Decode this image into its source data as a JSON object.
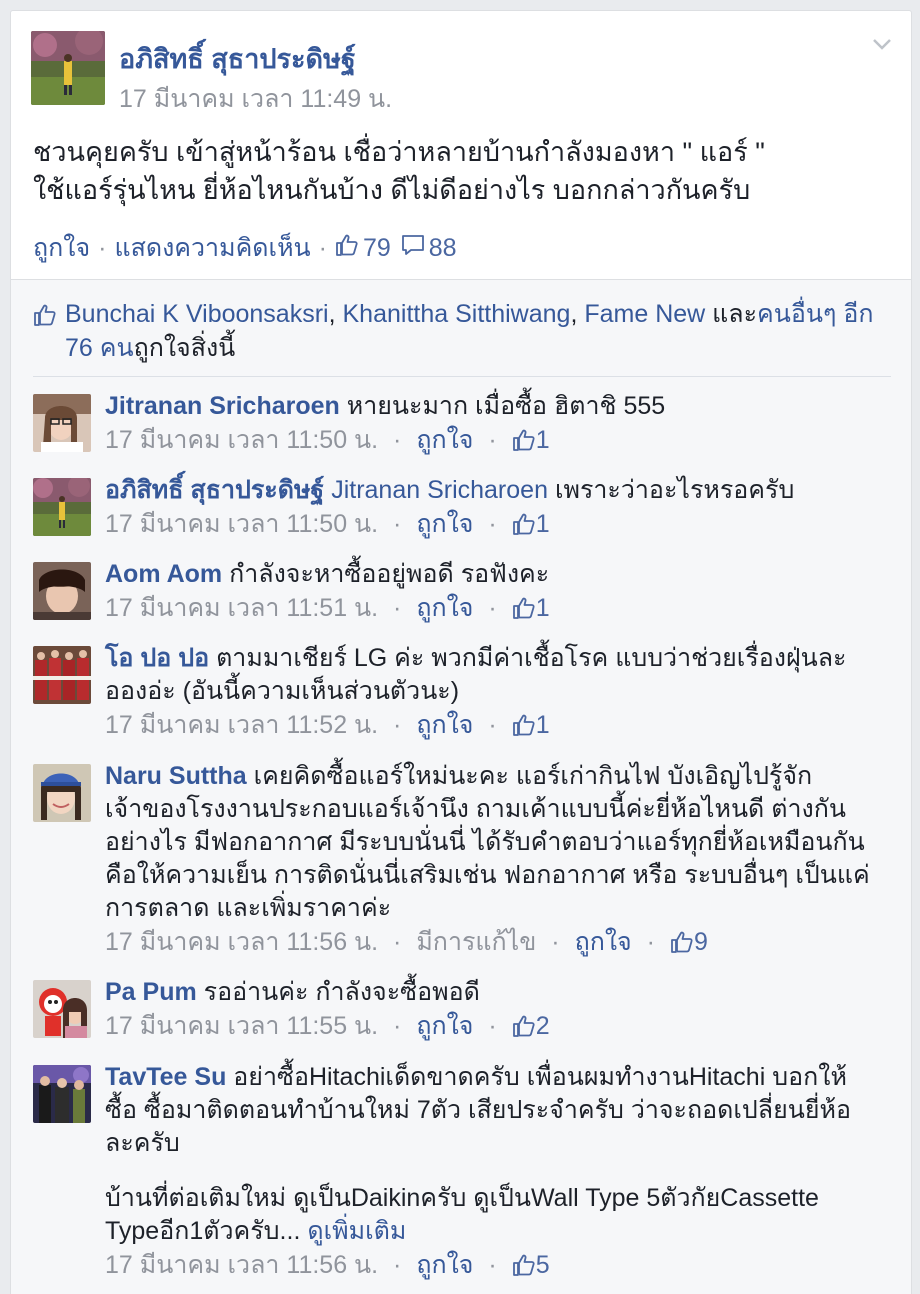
{
  "post": {
    "author": "อภิสิทธิ์ สุธาประดิษฐ์",
    "time": "17 มีนาคม เวลา 11:49 น.",
    "text_line1": "ชวนคุยครับ เข้าสู่หน้าร้อน เชื่อว่าหลายบ้านกำลังมองหา \" แอร์ \"",
    "text_line2": "ใช้แอร์รุ่นไหน ยี่ห้อไหนกันบ้าง ดีไม่ดีอย่างไร บอกกล่าวกันครับ",
    "like_action": "ถูกใจ",
    "comment_action": "แสดงความคิดเห็น",
    "like_count": "79",
    "comment_count": "88",
    "menu_icon": "chevron-down-icon"
  },
  "likes_summary": {
    "name1": "Bunchai K Viboonsaksri",
    "name2": "Khanittha Sitthiwang",
    "name3": "Fame New",
    "and": "และ",
    "others": "คนอื่นๆ อีก 76 คน",
    "suffix": "ถูกใจสิ่งนี้",
    "comma": ", "
  },
  "comments": [
    {
      "name": "Jitranan Sricharoen",
      "text": "หายนะมาก เมื่อซื้อ ฮิตาชิ 555",
      "time": "17 มีนาคม เวลา 11:50 น.",
      "like": "ถูกใจ",
      "likes": "1"
    },
    {
      "name": "อภิสิทธิ์ สุธาประดิษฐ์",
      "tag": "Jitranan Sricharoen",
      "text": "เพราะว่าอะไรหรอครับ",
      "time": "17 มีนาคม เวลา 11:50 น.",
      "like": "ถูกใจ",
      "likes": "1"
    },
    {
      "name": "Aom Aom",
      "text": "กำลังจะหาซื้ออยู่พอดี รอฟังคะ",
      "time": "17 มีนาคม เวลา 11:51 น.",
      "like": "ถูกใจ",
      "likes": "1"
    },
    {
      "name": "โอ ปอ ปอ",
      "text": "ตามมาเชียร์ LG ค่ะ พวกมีค่าเชื้อโรค แบบว่าช่วยเรื่องฝุ่นละอองอ่ะ (อันนี้ความเห็นส่วนตัวนะ)",
      "time": "17 มีนาคม เวลา 11:52 น.",
      "like": "ถูกใจ",
      "likes": "1"
    },
    {
      "name": "Naru Suttha",
      "text": "เคยคิดซื้อแอร์ใหม่นะคะ แอร์เก่ากินไฟ บังเอิญไปรู้จักเจ้าของโรงงานประกอบแอร์เจ้านึง ถามเค้าแบบนี้ค่ะยี่ห้อไหนดี ต่างกันอย่างไร มีฟอกอากาศ มีระบบนั่นนี่ ได้รับคำตอบว่าแอร์ทุกยี่ห้อเหมือนกันคือให้ความเย็น การติดนั่นนี่เสริมเช่น ฟอกอากาศ หรือ ระบบอื่นๆ เป็นแค่การตลาด และเพิ่มราคาค่ะ",
      "time": "17 มีนาคม เวลา 11:56 น.",
      "edited": "มีการแก้ไข",
      "like": "ถูกใจ",
      "likes": "9"
    },
    {
      "name": "Pa Pum",
      "text": "รออ่านค่ะ กำลังจะซื้อพอดี",
      "time": "17 มีนาคม เวลา 11:55 น.",
      "like": "ถูกใจ",
      "likes": "2"
    },
    {
      "name": "TavTee Su",
      "text": "อย่าซื้อHitachiเด็ดขาดครับ เพื่อนผมทำงานHitachi บอกให้ซื้อ ซื้อมาติดตอนทำบ้านใหม่ 7ตัว เสียประจำครับ ว่าจะถอดเปลี่ยนยี่ห้อละครับ",
      "text2": "บ้านที่ต่อเติมใหม่ ดูเป็นDaikinครับ ดูเป็นWall Type 5ตัวกัยCassette Typeอีก1ตัวครับ...",
      "see_more": "ดูเพิ่มเติม",
      "time": "17 มีนาคม เวลา 11:56 น.",
      "like": "ถูกใจ",
      "likes": "5"
    }
  ],
  "separator": "·"
}
